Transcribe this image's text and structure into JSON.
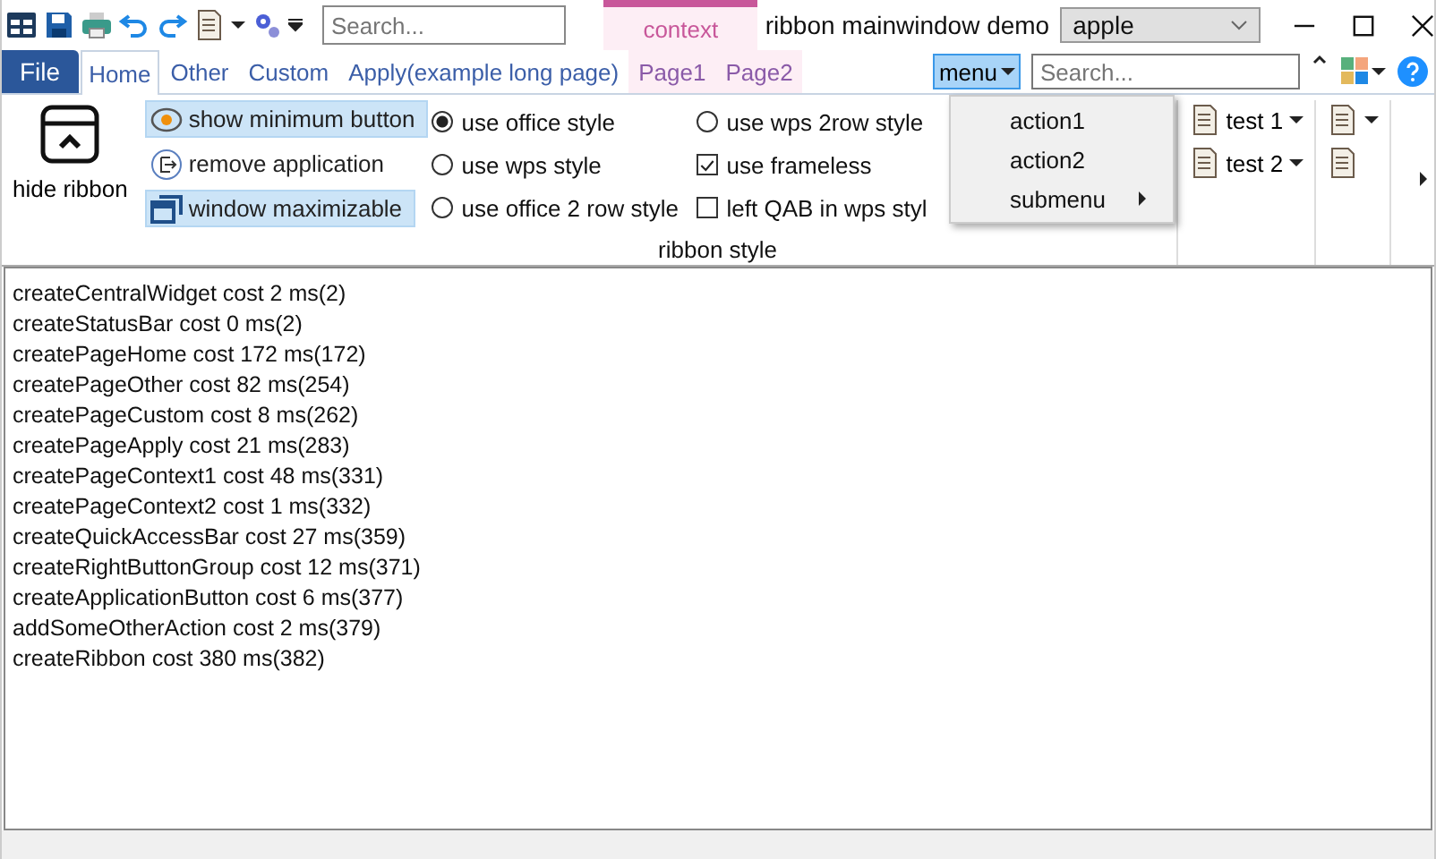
{
  "quick_access": {
    "search_placeholder": "Search..."
  },
  "context_category": {
    "label": "context"
  },
  "window": {
    "title": "ribbon mainwindow demo",
    "combo_value": "apple"
  },
  "file_button": {
    "label": "File"
  },
  "tabs": [
    {
      "label": "Home",
      "selected": true,
      "kind": "page"
    },
    {
      "label": "Other",
      "selected": false,
      "kind": "page"
    },
    {
      "label": "Custom",
      "selected": false,
      "kind": "page"
    },
    {
      "label": "Apply(example long page)",
      "selected": false,
      "kind": "page"
    },
    {
      "label": "Page1",
      "selected": false,
      "kind": "context"
    },
    {
      "label": "Page2",
      "selected": false,
      "kind": "context"
    }
  ],
  "right_bar": {
    "menu_button": "menu",
    "search_placeholder": "Search..."
  },
  "ribbon": {
    "hide_button": "hide ribbon",
    "actions": [
      {
        "label": "show minimum button",
        "checked": true,
        "kind": "eye"
      },
      {
        "label": "remove application",
        "checked": false,
        "kind": "exit"
      },
      {
        "label": "window maximizable",
        "checked": true,
        "kind": "window"
      }
    ],
    "style_options": [
      {
        "kind": "radio",
        "label": "use office style",
        "checked": true
      },
      {
        "kind": "radio",
        "label": "use wps style",
        "checked": false
      },
      {
        "kind": "radio",
        "label": "use office 2 row style",
        "checked": false
      },
      {
        "kind": "radio",
        "label": "use wps 2row style",
        "checked": false
      },
      {
        "kind": "checkbox",
        "label": "use frameless",
        "checked": true
      },
      {
        "kind": "checkbox",
        "label": "left QAB in wps styl",
        "checked": false
      }
    ],
    "group_label": "ribbon style",
    "test_buttons": [
      "test 1",
      "test 2"
    ]
  },
  "menu": {
    "items": [
      {
        "label": "action1",
        "kind": "action"
      },
      {
        "label": "action2",
        "kind": "action"
      },
      {
        "label": "submenu",
        "kind": "submenu"
      }
    ]
  },
  "log": [
    "createCentralWidget cost 2 ms(2)",
    "createStatusBar cost 0 ms(2)",
    "createPageHome cost 172 ms(172)",
    "createPageOther cost 82 ms(254)",
    "createPageCustom cost 8 ms(262)",
    "createPageApply cost 21 ms(283)",
    "createPageContext1 cost 48 ms(331)",
    "createPageContext2 cost 1 ms(332)",
    "createQuickAccessBar cost 27 ms(359)",
    "createRightButtonGroup cost 12 ms(371)",
    "createApplicationButton cost 6 ms(377)",
    "addSomeOtherAction cost 2 ms(379)",
    "createRibbon cost 380 ms(382)"
  ]
}
